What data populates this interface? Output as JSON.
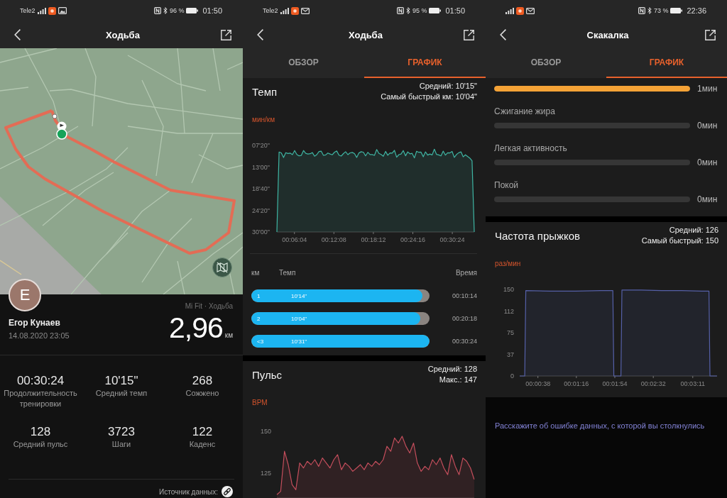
{
  "screens": [
    {
      "kind": "overview",
      "status_bar": {
        "carrier": "Tele2",
        "battery": "96 %",
        "time": "01:50"
      },
      "header": {
        "title": "Ходьба"
      },
      "profile": {
        "initial": "E",
        "name": "Егор Кунаев",
        "date": "14.08.2020 23:05"
      },
      "source": "Mi Fit · Ходьба",
      "distance": {
        "value": "2,96",
        "unit": "км"
      },
      "stats": [
        {
          "value": "00:30:24",
          "label": "Продолжительность тренировки"
        },
        {
          "value": "10'15\"",
          "label": "Средний темп"
        },
        {
          "value": "268",
          "label": "Сожжено"
        },
        {
          "value": "128",
          "label": "Средний пульс"
        },
        {
          "value": "3723",
          "label": "Шаги"
        },
        {
          "value": "122",
          "label": "Каденс"
        }
      ],
      "data_source": "Источник данных:"
    },
    {
      "kind": "charts",
      "status_bar": {
        "carrier": "Tele2",
        "battery": "95 %",
        "time": "01:50"
      },
      "header": {
        "title": "Ходьба"
      },
      "tabs": [
        {
          "label": "ОБЗОР",
          "selected": false
        },
        {
          "label": "ГРАФИК",
          "selected": true
        }
      ],
      "sections": [
        {
          "kind": "chart",
          "title": "Темп",
          "summary": [
            "Средний: 10'15\"",
            "Самый быстрый км: 10'04\""
          ],
          "unit": "мин/км",
          "y_labels": [
            "07'20\"",
            "13'00\"",
            "18'40\"",
            "24'20\"",
            "30'00\""
          ],
          "x_labels": [
            "00:06:04",
            "00:12:08",
            "00:18:12",
            "00:24:16",
            "00:30:24"
          ]
        },
        {
          "kind": "splits",
          "columns": [
            "км",
            "Темп",
            "Время"
          ],
          "rows": [
            {
              "km": "1",
              "pace": "10'14\"",
              "time": "00:10:14",
              "level": 0.96
            },
            {
              "km": "2",
              "pace": "10'04\"",
              "time": "00:20:18",
              "level": 0.95
            },
            {
              "km": "<3",
              "pace": "10'31\"",
              "time": "00:30:24",
              "level": 1
            }
          ]
        },
        {
          "kind": "chart",
          "title": "Пульс",
          "summary": [
            "Средний: 128",
            "Макс.: 147"
          ],
          "unit": "BPM",
          "chart_data": {
            "type": "area",
            "series": [
              {
                "color": "#c44e5c",
                "values": [
                  112,
                  114,
                  138,
                  130,
                  118,
                  115,
                  131,
                  128,
                  132,
                  130,
                  133,
                  129,
                  134,
                  131,
                  128,
                  133,
                  136,
                  127,
                  131,
                  129,
                  126,
                  128,
                  130,
                  127,
                  131,
                  129,
                  132,
                  130,
                  133,
                  141,
                  138,
                  146,
                  143,
                  147,
                  141,
                  137,
                  143,
                  131,
                  126,
                  129,
                  127,
                  133,
                  130,
                  134,
                  128,
                  124,
                  136,
                  129,
                  124,
                  134,
                  132,
                  128,
                  121
                ]
              }
            ],
            "ylim": [
              110,
              150
            ],
            "yticks": [
              150,
              125
            ]
          }
        }
      ]
    },
    {
      "kind": "charts",
      "status_bar": {
        "battery": "73 %",
        "time": "22:36"
      },
      "header": {
        "title": "Скакалка"
      },
      "tabs": [
        {
          "label": "ОБЗОР",
          "selected": false
        },
        {
          "label": "ГРАФИК",
          "selected": true
        }
      ],
      "sections": [
        {
          "kind": "zones",
          "rows": [
            {
              "value": "1мин",
              "level": 1
            },
            {
              "label": "Сжигание жира",
              "value": "0мин",
              "level": 0
            },
            {
              "label": "Легкая активность",
              "value": "0мин",
              "level": 0
            },
            {
              "label": "Покой",
              "value": "0мин",
              "level": 0
            }
          ]
        },
        {
          "kind": "chart",
          "title": "Частота прыжков",
          "summary": [
            "Средний: 126",
            "Самый быстрый: 150"
          ],
          "unit": "раз/мин",
          "chart_data": {
            "type": "area",
            "x": [
              20,
              25,
              26,
              50,
              75,
              100,
              112,
              113,
              120,
              121,
              140,
              160,
              180,
              200,
              207,
              208,
              215
            ],
            "series": [
              {
                "color": "#5560a8",
                "values": [
                  0,
                  0,
                  148,
                  147,
                  147,
                  148,
                  148,
                  0,
                  0,
                  149,
                  149,
                  148,
                  148,
                  147,
                  147,
                  0,
                  0
                ]
              }
            ],
            "xlim": [
              20,
              215
            ],
            "ylim": [
              0,
              150
            ],
            "xticks": [
              {
                "value": 38,
                "label": "00:00:38"
              },
              {
                "value": 76,
                "label": "00:01:16"
              },
              {
                "value": 114,
                "label": "00:01:54"
              },
              {
                "value": 152,
                "label": "00:02:32"
              },
              {
                "value": 191,
                "label": "00:03:11"
              }
            ],
            "yticks": [
              150,
              {
                "value": 112.5,
                "label": "112"
              },
              75,
              {
                "value": 37.5,
                "label": "37"
              },
              0
            ]
          }
        },
        {
          "kind": "link",
          "text": "Расскажите об ошибке данных, с которой вы столкнулись"
        }
      ]
    }
  ]
}
